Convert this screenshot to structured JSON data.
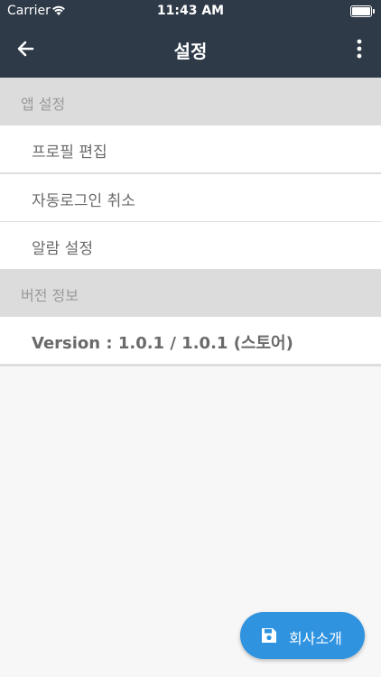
{
  "status_bar": {
    "carrier": "Carrier",
    "time": "11:43 AM"
  },
  "header": {
    "title": "설정",
    "back_icon": "arrow-left-icon",
    "more_icon": "more-vertical-icon"
  },
  "sections": [
    {
      "title": "앱 설정",
      "items": [
        "프로필 편집",
        "자동로그인 취소",
        "알람 설정"
      ]
    },
    {
      "title": "버전 정보",
      "items": [
        "Version : 1.0.1 / 1.0.1 (스토어)"
      ]
    }
  ],
  "fab": {
    "label": "회사소개",
    "icon": "save-icon"
  },
  "colors": {
    "header_bg": "#2e3a48",
    "accent": "#2f93e0",
    "section_bg": "#dcdcdc"
  }
}
